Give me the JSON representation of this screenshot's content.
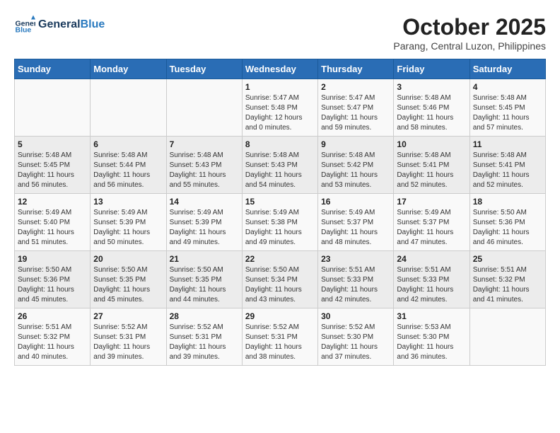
{
  "header": {
    "logo_line1": "General",
    "logo_line2": "Blue",
    "month": "October 2025",
    "location": "Parang, Central Luzon, Philippines"
  },
  "weekdays": [
    "Sunday",
    "Monday",
    "Tuesday",
    "Wednesday",
    "Thursday",
    "Friday",
    "Saturday"
  ],
  "weeks": [
    [
      {
        "day": "",
        "info": ""
      },
      {
        "day": "",
        "info": ""
      },
      {
        "day": "",
        "info": ""
      },
      {
        "day": "1",
        "info": "Sunrise: 5:47 AM\nSunset: 5:48 PM\nDaylight: 12 hours\nand 0 minutes."
      },
      {
        "day": "2",
        "info": "Sunrise: 5:47 AM\nSunset: 5:47 PM\nDaylight: 11 hours\nand 59 minutes."
      },
      {
        "day": "3",
        "info": "Sunrise: 5:48 AM\nSunset: 5:46 PM\nDaylight: 11 hours\nand 58 minutes."
      },
      {
        "day": "4",
        "info": "Sunrise: 5:48 AM\nSunset: 5:45 PM\nDaylight: 11 hours\nand 57 minutes."
      }
    ],
    [
      {
        "day": "5",
        "info": "Sunrise: 5:48 AM\nSunset: 5:45 PM\nDaylight: 11 hours\nand 56 minutes."
      },
      {
        "day": "6",
        "info": "Sunrise: 5:48 AM\nSunset: 5:44 PM\nDaylight: 11 hours\nand 56 minutes."
      },
      {
        "day": "7",
        "info": "Sunrise: 5:48 AM\nSunset: 5:43 PM\nDaylight: 11 hours\nand 55 minutes."
      },
      {
        "day": "8",
        "info": "Sunrise: 5:48 AM\nSunset: 5:43 PM\nDaylight: 11 hours\nand 54 minutes."
      },
      {
        "day": "9",
        "info": "Sunrise: 5:48 AM\nSunset: 5:42 PM\nDaylight: 11 hours\nand 53 minutes."
      },
      {
        "day": "10",
        "info": "Sunrise: 5:48 AM\nSunset: 5:41 PM\nDaylight: 11 hours\nand 52 minutes."
      },
      {
        "day": "11",
        "info": "Sunrise: 5:48 AM\nSunset: 5:41 PM\nDaylight: 11 hours\nand 52 minutes."
      }
    ],
    [
      {
        "day": "12",
        "info": "Sunrise: 5:49 AM\nSunset: 5:40 PM\nDaylight: 11 hours\nand 51 minutes."
      },
      {
        "day": "13",
        "info": "Sunrise: 5:49 AM\nSunset: 5:39 PM\nDaylight: 11 hours\nand 50 minutes."
      },
      {
        "day": "14",
        "info": "Sunrise: 5:49 AM\nSunset: 5:39 PM\nDaylight: 11 hours\nand 49 minutes."
      },
      {
        "day": "15",
        "info": "Sunrise: 5:49 AM\nSunset: 5:38 PM\nDaylight: 11 hours\nand 49 minutes."
      },
      {
        "day": "16",
        "info": "Sunrise: 5:49 AM\nSunset: 5:37 PM\nDaylight: 11 hours\nand 48 minutes."
      },
      {
        "day": "17",
        "info": "Sunrise: 5:49 AM\nSunset: 5:37 PM\nDaylight: 11 hours\nand 47 minutes."
      },
      {
        "day": "18",
        "info": "Sunrise: 5:50 AM\nSunset: 5:36 PM\nDaylight: 11 hours\nand 46 minutes."
      }
    ],
    [
      {
        "day": "19",
        "info": "Sunrise: 5:50 AM\nSunset: 5:36 PM\nDaylight: 11 hours\nand 45 minutes."
      },
      {
        "day": "20",
        "info": "Sunrise: 5:50 AM\nSunset: 5:35 PM\nDaylight: 11 hours\nand 45 minutes."
      },
      {
        "day": "21",
        "info": "Sunrise: 5:50 AM\nSunset: 5:35 PM\nDaylight: 11 hours\nand 44 minutes."
      },
      {
        "day": "22",
        "info": "Sunrise: 5:50 AM\nSunset: 5:34 PM\nDaylight: 11 hours\nand 43 minutes."
      },
      {
        "day": "23",
        "info": "Sunrise: 5:51 AM\nSunset: 5:33 PM\nDaylight: 11 hours\nand 42 minutes."
      },
      {
        "day": "24",
        "info": "Sunrise: 5:51 AM\nSunset: 5:33 PM\nDaylight: 11 hours\nand 42 minutes."
      },
      {
        "day": "25",
        "info": "Sunrise: 5:51 AM\nSunset: 5:32 PM\nDaylight: 11 hours\nand 41 minutes."
      }
    ],
    [
      {
        "day": "26",
        "info": "Sunrise: 5:51 AM\nSunset: 5:32 PM\nDaylight: 11 hours\nand 40 minutes."
      },
      {
        "day": "27",
        "info": "Sunrise: 5:52 AM\nSunset: 5:31 PM\nDaylight: 11 hours\nand 39 minutes."
      },
      {
        "day": "28",
        "info": "Sunrise: 5:52 AM\nSunset: 5:31 PM\nDaylight: 11 hours\nand 39 minutes."
      },
      {
        "day": "29",
        "info": "Sunrise: 5:52 AM\nSunset: 5:31 PM\nDaylight: 11 hours\nand 38 minutes."
      },
      {
        "day": "30",
        "info": "Sunrise: 5:52 AM\nSunset: 5:30 PM\nDaylight: 11 hours\nand 37 minutes."
      },
      {
        "day": "31",
        "info": "Sunrise: 5:53 AM\nSunset: 5:30 PM\nDaylight: 11 hours\nand 36 minutes."
      },
      {
        "day": "",
        "info": ""
      }
    ]
  ]
}
